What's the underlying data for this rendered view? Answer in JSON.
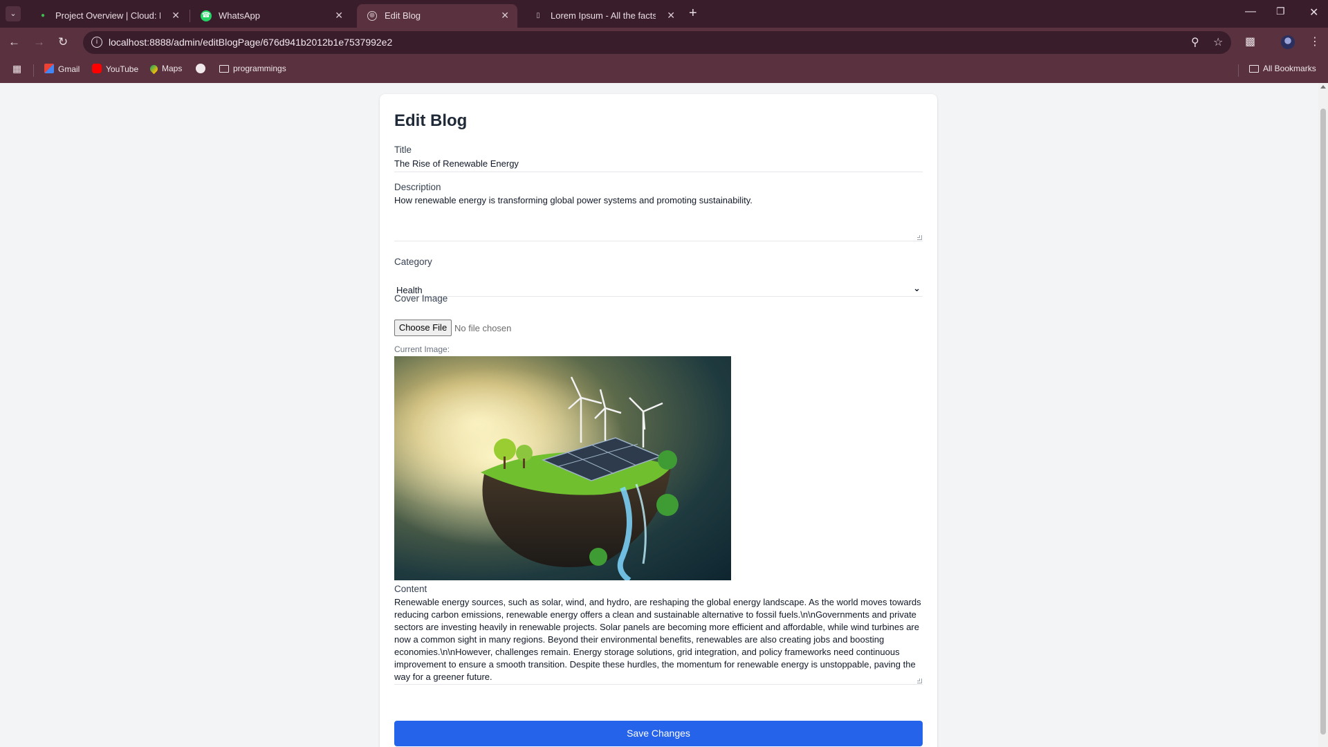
{
  "browser": {
    "tabs": [
      {
        "title": "Project Overview | Cloud: Mongo",
        "icon": "leaf-icon"
      },
      {
        "title": "WhatsApp",
        "icon": "whatsapp-icon"
      },
      {
        "title": "Edit Blog",
        "icon": "globe-icon"
      },
      {
        "title": "Lorem Ipsum - All the facts - Lip",
        "icon": "page-icon"
      }
    ],
    "url": "localhost:8888/admin/editBlogPage/676d941b2012b1e7537992e2",
    "bookmarks": [
      {
        "label": "Gmail",
        "icon": "gmail-icon"
      },
      {
        "label": "YouTube",
        "icon": "youtube-icon"
      },
      {
        "label": "Maps",
        "icon": "maps-icon"
      },
      {
        "label": "",
        "icon": "github-icon"
      },
      {
        "label": "programmings",
        "icon": "folder-icon"
      }
    ],
    "all_bookmarks": "All Bookmarks"
  },
  "form": {
    "heading": "Edit Blog",
    "title_label": "Title",
    "title_value": "The Rise of Renewable Energy",
    "description_label": "Description",
    "description_value": "How renewable energy is transforming global power systems and promoting sustainability.",
    "category_label": "Category",
    "category_value": "Health",
    "cover_label": "Cover Image",
    "file_button": "Choose File",
    "file_status": "No file chosen",
    "current_image_label": "Current Image:",
    "content_label": "Content",
    "content_value": "Renewable energy sources, such as solar, wind, and hydro, are reshaping the global energy landscape. As the world moves towards reducing carbon emissions, renewable energy offers a clean and sustainable alternative to fossil fuels.\\n\\nGovernments and private sectors are investing heavily in renewable projects. Solar panels are becoming more efficient and affordable, while wind turbines are now a common sight in many regions. Beyond their environmental benefits, renewables are also creating jobs and boosting economies.\\n\\nHowever, challenges remain. Energy storage solutions, grid integration, and policy frameworks need continuous improvement to ensure a smooth transition. Despite these hurdles, the momentum for renewable energy is unstoppable, paving the way for a greener future.",
    "save_button": "Save Changes"
  },
  "colors": {
    "chrome_dark": "#3a1d2b",
    "chrome": "#59313f",
    "primary_button": "#2563eb"
  }
}
